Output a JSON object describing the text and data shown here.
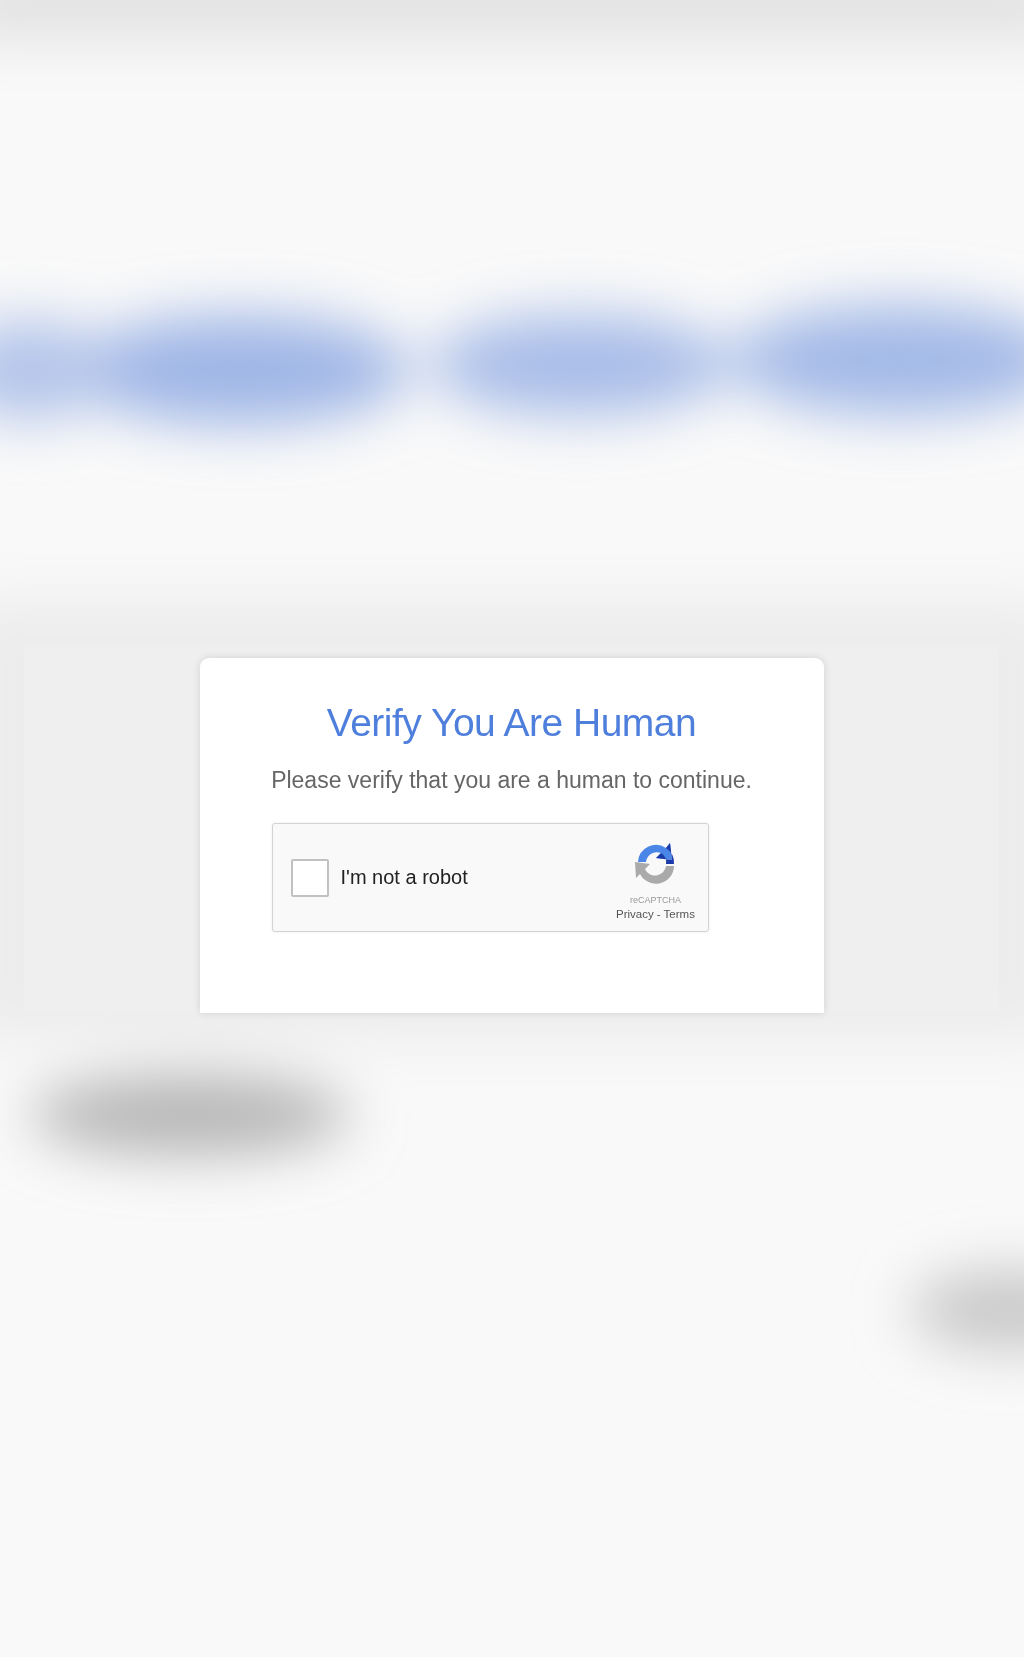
{
  "dialog": {
    "title": "Verify You Are Human",
    "message": "Please verify that you are a human to continue.",
    "captcha": {
      "label": "I'm not a robot",
      "checked": false,
      "brand": "reCAPTCHA",
      "links": [
        {
          "label": "Privacy"
        },
        {
          "label": "Terms"
        }
      ],
      "separator": "-"
    }
  }
}
